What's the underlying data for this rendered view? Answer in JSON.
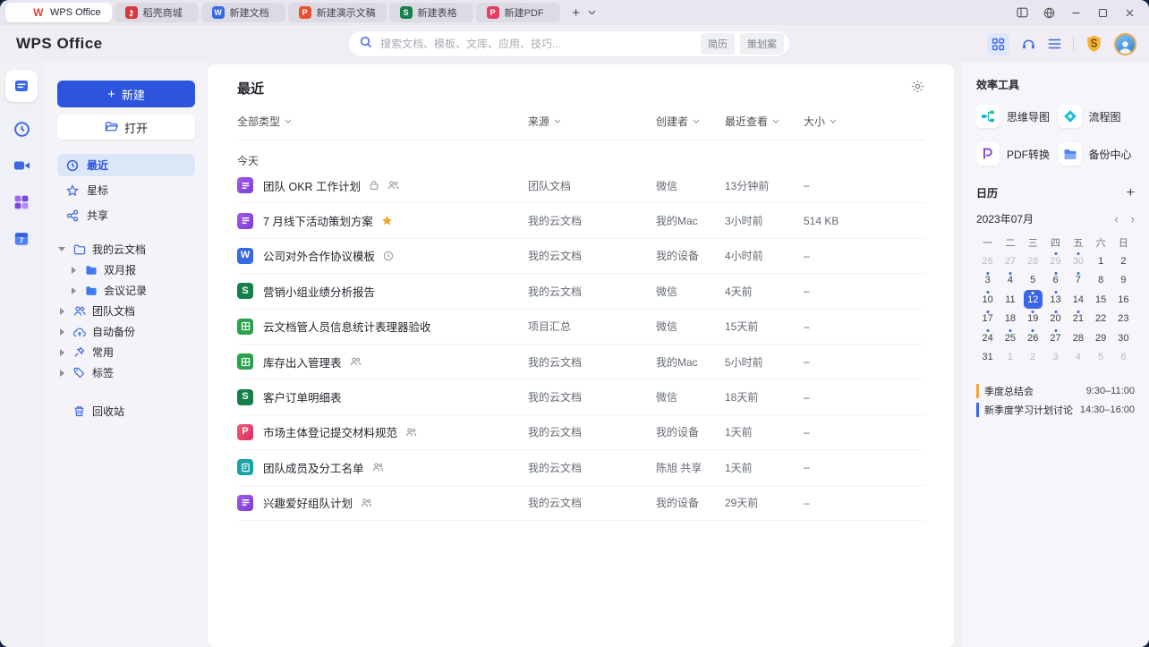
{
  "tabbar": {
    "tabs": [
      {
        "label": "WPS Office",
        "icon": "wps-logo",
        "active": true
      },
      {
        "label": "稻壳商城",
        "icon": "docer",
        "active": false
      },
      {
        "label": "新建文档",
        "icon": "writer",
        "active": false
      },
      {
        "label": "新建演示文稿",
        "icon": "presentation",
        "active": false
      },
      {
        "label": "新建表格",
        "icon": "spreadsheet",
        "active": false
      },
      {
        "label": "新建PDF",
        "icon": "pdf",
        "active": false
      }
    ],
    "new_tab": "+"
  },
  "window_controls": [
    "split-view",
    "globe",
    "minimize",
    "maximize",
    "close"
  ],
  "header": {
    "logo": "WPS Office",
    "search": {
      "placeholder": "搜索文档、模板、文库、应用、技巧...",
      "tags": [
        "简历",
        "策划案"
      ]
    }
  },
  "rail": {
    "items": [
      "documents",
      "clock",
      "meeting",
      "apps",
      "calendar-7"
    ]
  },
  "sidebar": {
    "new_button": "新建",
    "open_button": "打开",
    "nav": [
      {
        "label": "最近",
        "icon": "clock",
        "active": true
      },
      {
        "label": "星标",
        "icon": "star",
        "active": false
      },
      {
        "label": "共享",
        "icon": "share",
        "active": false
      }
    ],
    "tree": {
      "root": {
        "label": "我的云文档"
      },
      "children": [
        {
          "label": "双月报"
        },
        {
          "label": "会议记录"
        }
      ],
      "siblings": [
        {
          "label": "团队文档",
          "icon": "team"
        },
        {
          "label": "自动备份",
          "icon": "cloud-backup"
        },
        {
          "label": "常用",
          "icon": "pin"
        },
        {
          "label": "标签",
          "icon": "tag"
        }
      ]
    },
    "trash": {
      "label": "回收站"
    }
  },
  "main": {
    "title": "最近",
    "filters": {
      "type": "全部类型",
      "source": "来源",
      "creator": "创建者",
      "viewed": "最近查看",
      "size": "大小"
    },
    "group": "今天",
    "files": [
      {
        "name": "团队 OKR 工作计划",
        "type": "otl",
        "badges": [
          "lock",
          "members"
        ],
        "source": "团队文档",
        "creator": "微信",
        "viewed": "13分钟前",
        "size": "–"
      },
      {
        "name": "7 月线下活动策划方案",
        "type": "otl",
        "badges": [
          "star"
        ],
        "source": "我的云文档",
        "creator": "我的Mac",
        "viewed": "3小时前",
        "size": "514 KB"
      },
      {
        "name": "公司对外合作协议模板",
        "type": "word",
        "badges": [
          "timer"
        ],
        "source": "我的云文档",
        "creator": "我的设备",
        "viewed": "4小时前",
        "size": "–"
      },
      {
        "name": "营销小组业绩分析报告",
        "type": "sheet",
        "badges": [],
        "source": "我的云文档",
        "creator": "微信",
        "viewed": "4天前",
        "size": "–"
      },
      {
        "name": "云文档管人员信息统计表理器验收",
        "type": "smartsheet",
        "badges": [],
        "source": "项目汇总",
        "creator": "微信",
        "viewed": "15天前",
        "size": "–"
      },
      {
        "name": "库存出入管理表",
        "type": "smartsheet",
        "badges": [
          "members"
        ],
        "source": "我的云文档",
        "creator": "我的Mac",
        "viewed": "5小时前",
        "size": "–"
      },
      {
        "name": "客户订单明细表",
        "type": "sheet",
        "badges": [],
        "source": "我的云文档",
        "creator": "微信",
        "viewed": "18天前",
        "size": "–"
      },
      {
        "name": "市场主体登记提交材料规范",
        "type": "pdf",
        "badges": [
          "members"
        ],
        "source": "我的云文档",
        "creator": "我的设备",
        "viewed": "1天前",
        "size": "–"
      },
      {
        "name": "团队成员及分工名单",
        "type": "form",
        "badges": [
          "members"
        ],
        "source": "我的云文档",
        "creator": "陈旭 共享",
        "viewed": "1天前",
        "size": "–"
      },
      {
        "name": "兴趣爱好组队计划",
        "type": "otl",
        "badges": [
          "members"
        ],
        "source": "我的云文档",
        "creator": "我的设备",
        "viewed": "29天前",
        "size": "–"
      }
    ]
  },
  "tools": {
    "title": "效率工具",
    "items": [
      {
        "label": "思维导图",
        "icon": "mindmap"
      },
      {
        "label": "流程图",
        "icon": "flowchart"
      },
      {
        "label": "PDF转换",
        "icon": "pdf-convert"
      },
      {
        "label": "备份中心",
        "icon": "backup-center"
      }
    ]
  },
  "calendar": {
    "title": "日历",
    "month": "2023年07月",
    "weekdays": [
      "一",
      "二",
      "三",
      "四",
      "五",
      "六",
      "日"
    ],
    "weeks": [
      [
        {
          "d": 26,
          "muted": true
        },
        {
          "d": 27,
          "muted": true
        },
        {
          "d": 28,
          "muted": true
        },
        {
          "d": 29,
          "muted": true,
          "dot": true
        },
        {
          "d": 30,
          "muted": true,
          "dot": true
        },
        {
          "d": 1
        },
        {
          "d": 2
        }
      ],
      [
        {
          "d": 3,
          "dot": true
        },
        {
          "d": 4,
          "dot": true
        },
        {
          "d": 5
        },
        {
          "d": 6,
          "dot": true
        },
        {
          "d": 7,
          "dot": true
        },
        {
          "d": 8
        },
        {
          "d": 9
        }
      ],
      [
        {
          "d": 10,
          "dot": true
        },
        {
          "d": 11
        },
        {
          "d": 12,
          "selected": true,
          "dot": true
        },
        {
          "d": 13,
          "dot": true
        },
        {
          "d": 14
        },
        {
          "d": 15
        },
        {
          "d": 16
        }
      ],
      [
        {
          "d": 17,
          "dot": true
        },
        {
          "d": 18
        },
        {
          "d": 19,
          "dot": true
        },
        {
          "d": 20,
          "dot": true
        },
        {
          "d": 21,
          "dot": true
        },
        {
          "d": 22
        },
        {
          "d": 23
        }
      ],
      [
        {
          "d": 24,
          "dot": true
        },
        {
          "d": 25,
          "dot": true
        },
        {
          "d": 26,
          "dot": true
        },
        {
          "d": 27,
          "dot": true
        },
        {
          "d": 28
        },
        {
          "d": 29
        },
        {
          "d": 30
        }
      ],
      [
        {
          "d": 31
        },
        {
          "d": 1,
          "muted": true
        },
        {
          "d": 2,
          "muted": true
        },
        {
          "d": 3,
          "muted": true
        },
        {
          "d": 4,
          "muted": true
        },
        {
          "d": 5,
          "muted": true
        },
        {
          "d": 6,
          "muted": true
        }
      ]
    ],
    "events": [
      {
        "title": "季度总结会",
        "time": "9:30–11:00",
        "color": "#f2a33c"
      },
      {
        "title": "新季度学习计划讨论",
        "time": "14:30–16:00",
        "color": "#3b66e8"
      }
    ]
  },
  "colors": {
    "accent": "#2d54dc",
    "accent_light": "#dce6f9",
    "star": "#f5a623",
    "calendar_dot": "#3b66e8"
  }
}
